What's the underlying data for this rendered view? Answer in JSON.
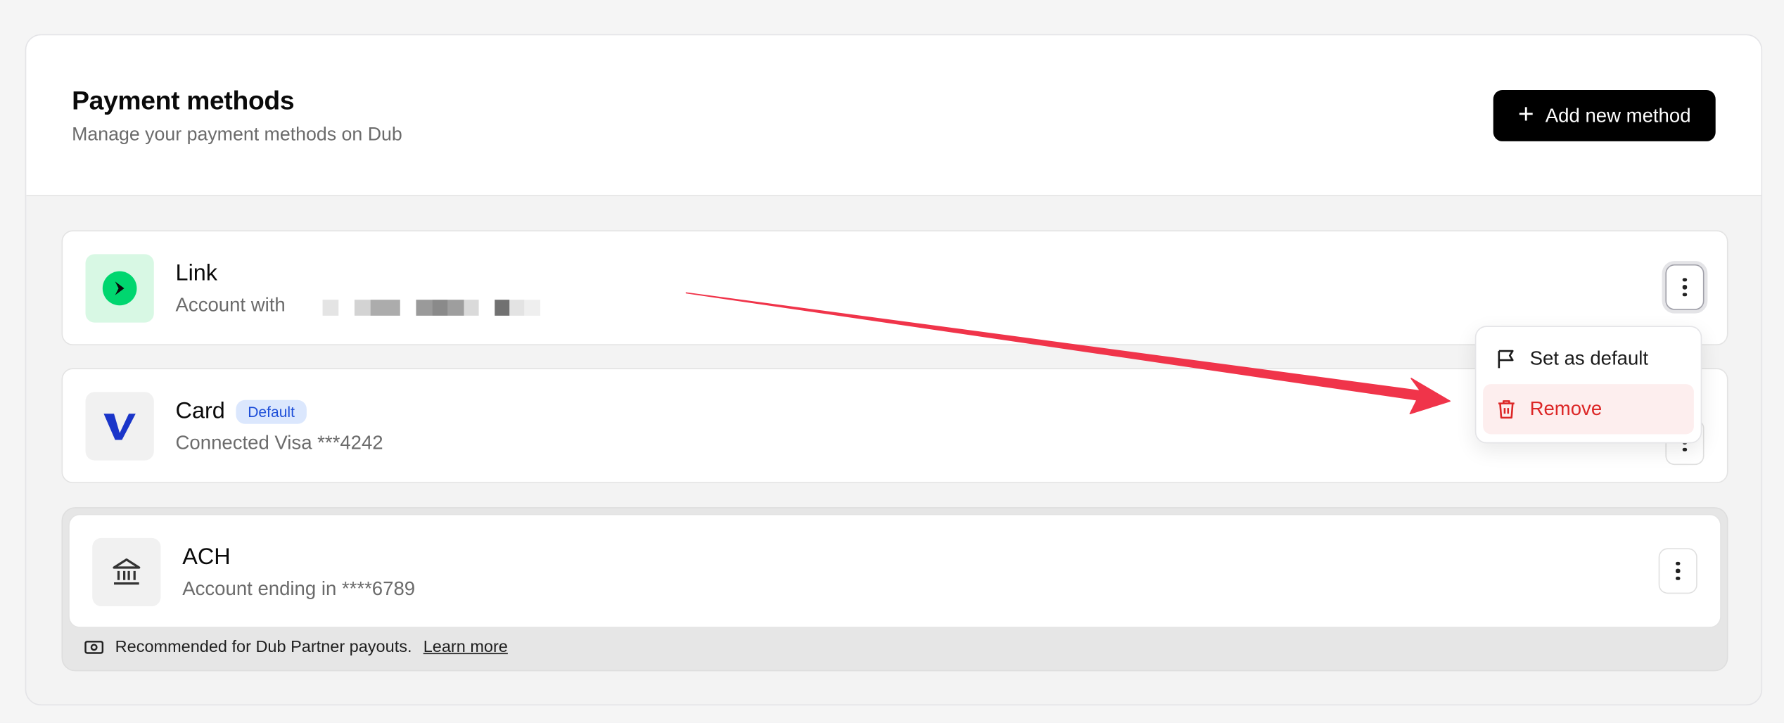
{
  "header": {
    "title": "Payment methods",
    "subtitle": "Manage your payment methods on Dub",
    "add_button": "Add new method"
  },
  "methods": [
    {
      "name": "Link",
      "detail": "Account with",
      "icon": "link-arrow-icon"
    },
    {
      "name": "Card",
      "badge": "Default",
      "detail": "Connected Visa ***4242",
      "icon": "visa-v-icon"
    },
    {
      "name": "ACH",
      "detail": "Account ending in ****6789",
      "icon": "bank-icon"
    }
  ],
  "ach_footer": {
    "text": "Recommended for Dub Partner payouts.",
    "link": "Learn more",
    "icon": "money-icon"
  },
  "menu": {
    "items": [
      {
        "label": "Set as default",
        "icon": "flag-icon"
      },
      {
        "label": "Remove",
        "icon": "trash-icon"
      }
    ]
  },
  "colors": {
    "primary_button": "#000000",
    "link_green": "#00d66f",
    "visa_blue": "#1a35c9",
    "badge_bg": "#dbe7fd",
    "badge_text": "#1d4ed8",
    "danger": "#dc2626",
    "annotation_arrow": "#f0344a"
  }
}
